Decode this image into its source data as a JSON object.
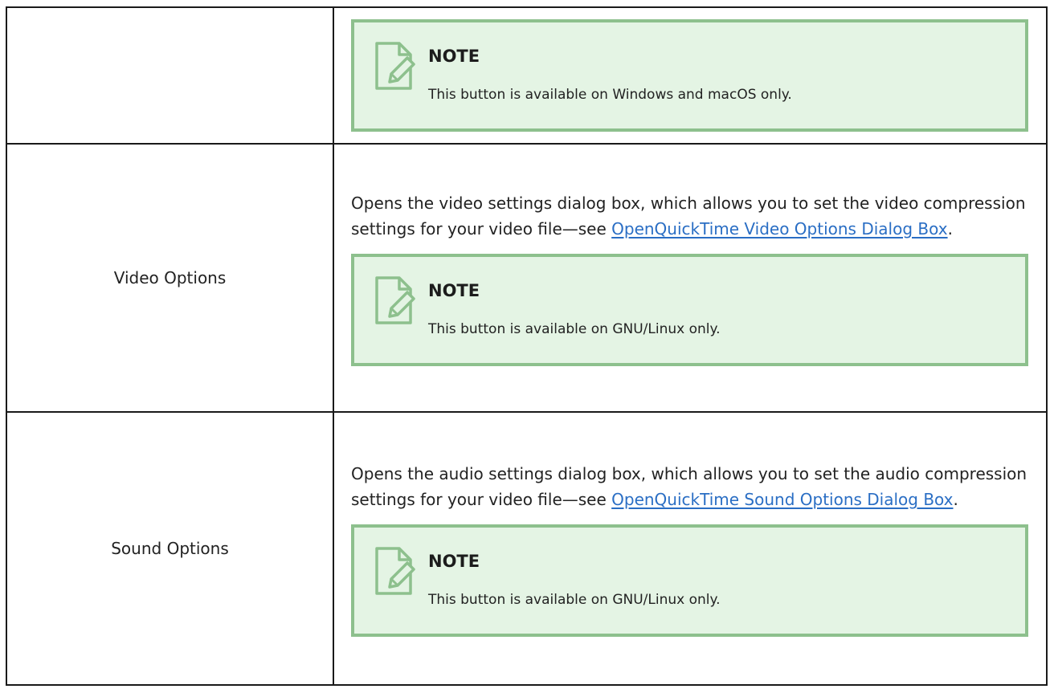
{
  "rows": [
    {
      "label": "",
      "note": {
        "title": "NOTE",
        "body": "This button is available on Windows and macOS only."
      }
    },
    {
      "label": "Video Options",
      "description": {
        "text": "Opens the video settings dialog box, which allows you to set the video compression settings for your video file—see ",
        "link": "OpenQuickTime Video Options Dialog Box",
        "suffix": "."
      },
      "note": {
        "title": "NOTE",
        "body": "This button is available on GNU/Linux only."
      }
    },
    {
      "label": "Sound Options",
      "description": {
        "text": "Opens the audio settings dialog box, which allows you to set the audio compression settings for your video file—see ",
        "link": "OpenQuickTime Sound Options Dialog Box",
        "suffix": "."
      },
      "note": {
        "title": "NOTE",
        "body": "This button is available on GNU/Linux only."
      }
    }
  ],
  "colors": {
    "note_background": "#e4f4e4",
    "note_border": "#8dc08d",
    "link": "#2a6ec4",
    "table_border": "#1a1a1a"
  },
  "icons": {
    "note": "note-pencil-icon"
  }
}
